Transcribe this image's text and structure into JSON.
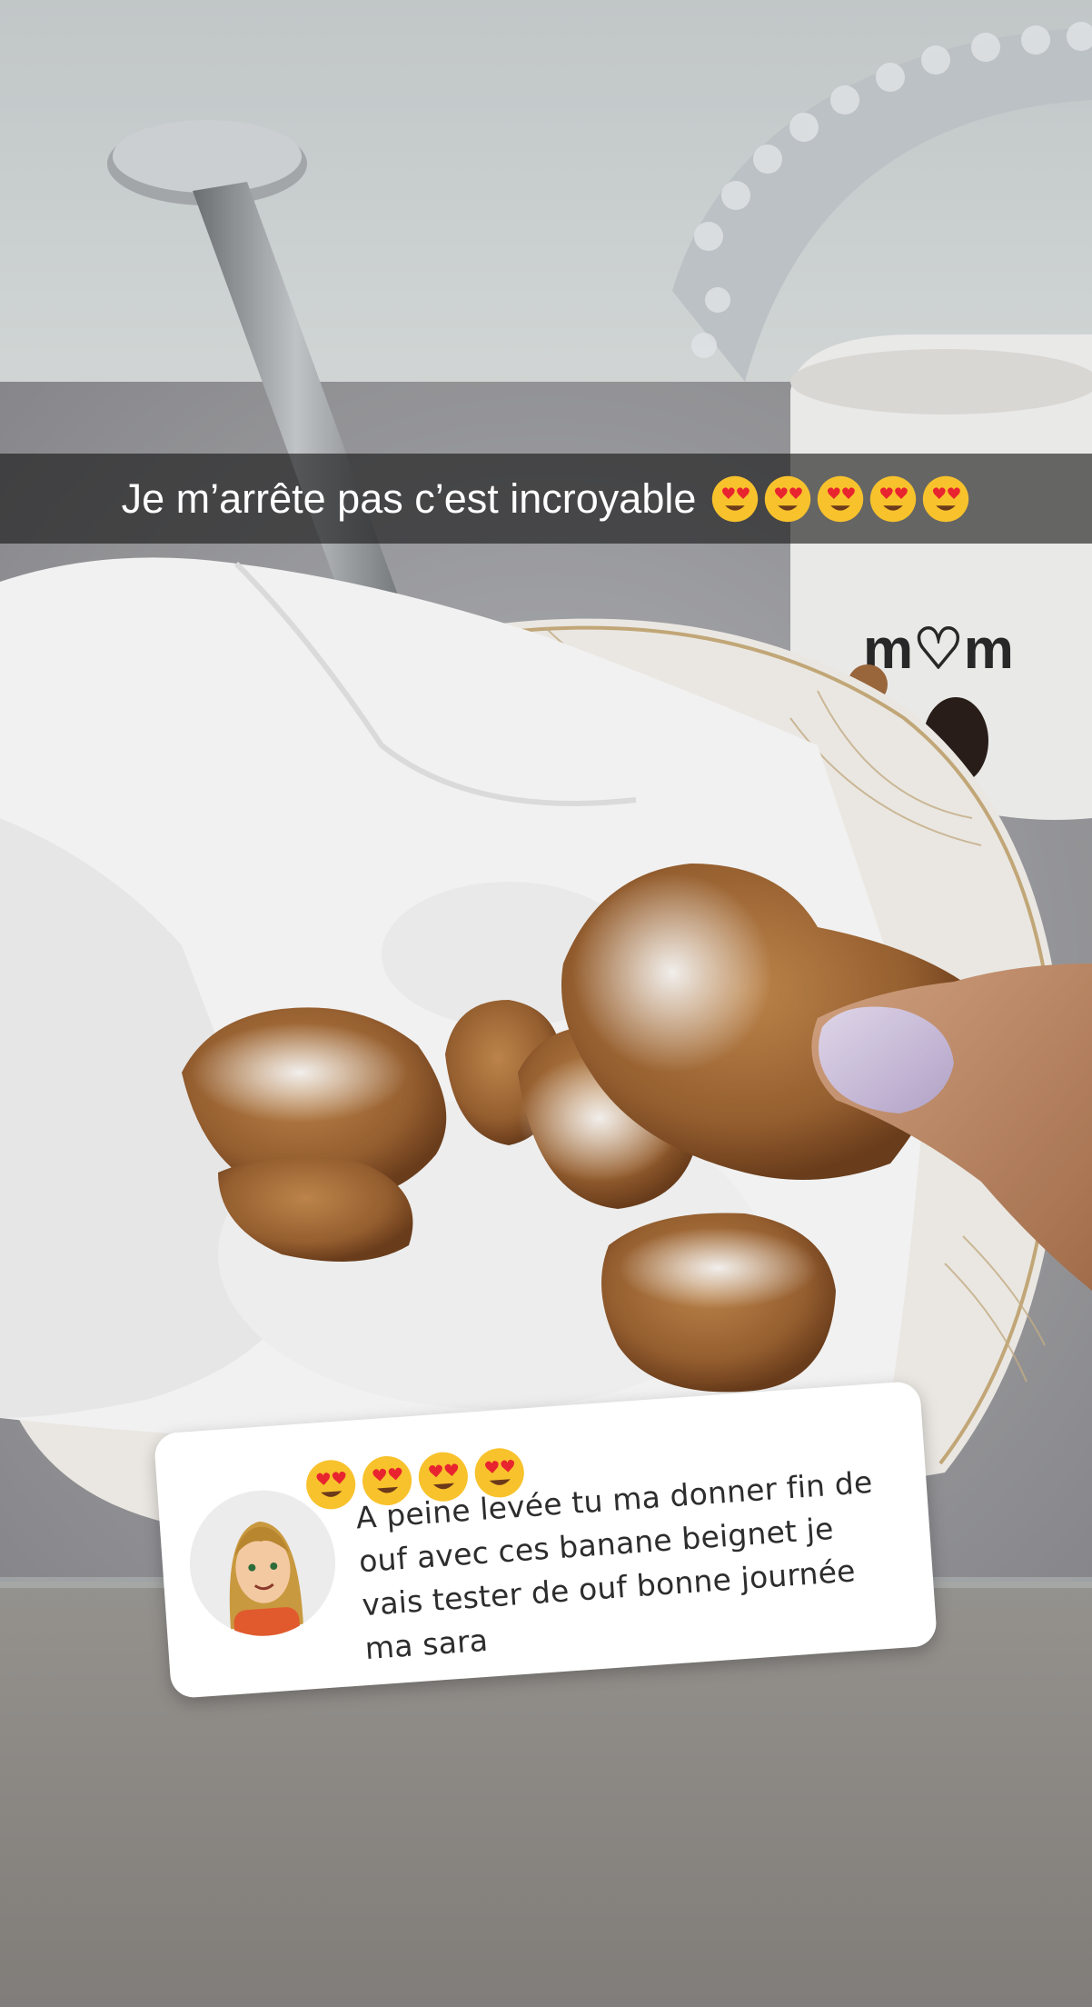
{
  "caption": {
    "text": "Je m’arrête pas c’est incroyable",
    "emoji_count": 5,
    "emoji_icon": "heart-eyes-emoji-icon"
  },
  "reply_sticker": {
    "emoji_count": 4,
    "emoji_icon": "heart-eyes-emoji-icon",
    "text": "A peine levée tu ma donner fin de ouf avec ces banane beignet je vais tester de ouf bonne journée ma sara",
    "avatar_icon": "bitmoji-avatar-icon"
  },
  "photo": {
    "mug_text": "mom"
  },
  "colors": {
    "caption_bar": "#141414",
    "sticker_bg": "#ffffff",
    "reply_text": "#2d2d2d",
    "emoji_face": "#f8c22c",
    "emoji_heart": "#e8242f"
  }
}
